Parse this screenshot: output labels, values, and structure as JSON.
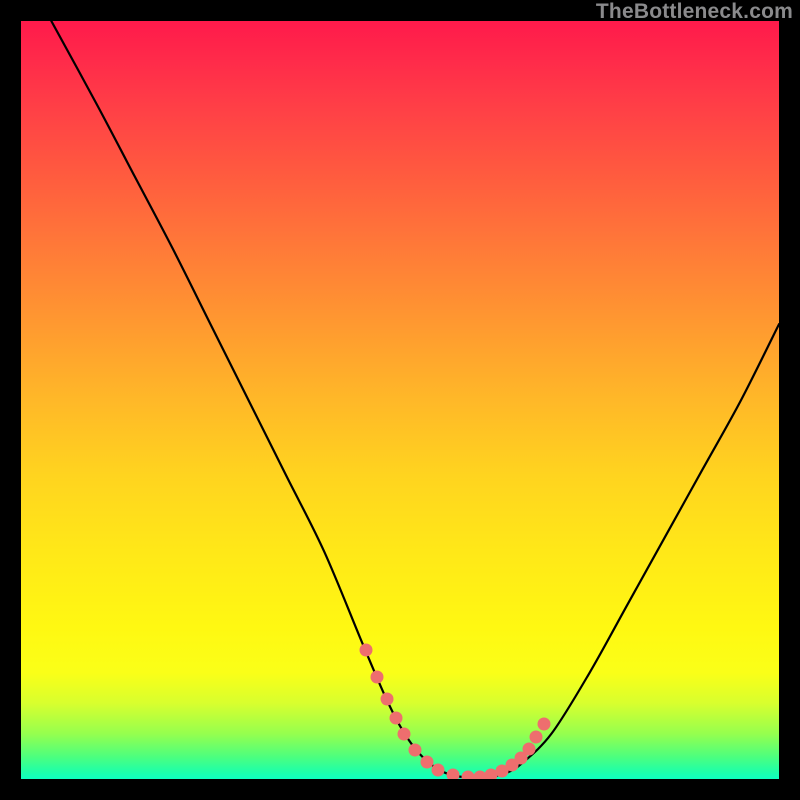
{
  "attribution": "TheBottleneck.com",
  "colors": {
    "page_bg": "#000000",
    "gradient_top": "#ff1a4b",
    "gradient_bottom": "#0effc0",
    "curve": "#000000",
    "dots": "#ee6e6e",
    "attribution": "#8a8a8c"
  },
  "chart_data": {
    "type": "line",
    "title": "",
    "xlabel": "",
    "ylabel": "",
    "xlim": [
      0,
      100
    ],
    "ylim": [
      0,
      100
    ],
    "grid": false,
    "legend": false,
    "series": [
      {
        "name": "bottleneck-curve",
        "x": [
          4,
          10,
          15,
          20,
          25,
          30,
          35,
          40,
          45,
          48,
          50,
          52,
          54,
          56,
          58,
          60,
          62,
          64,
          66,
          70,
          75,
          80,
          85,
          90,
          95,
          100
        ],
        "y": [
          100,
          89,
          79.5,
          70,
          60,
          50,
          40,
          30,
          18,
          11,
          7,
          4,
          2,
          0.8,
          0.3,
          0.2,
          0.3,
          0.8,
          2,
          6,
          14,
          23,
          32,
          41,
          50,
          60
        ]
      }
    ],
    "highlight_dots": {
      "name": "bottleneck-markers",
      "x": [
        45.5,
        47.0,
        48.3,
        49.5,
        50.5,
        52.0,
        53.5,
        55.0,
        57.0,
        59.0,
        60.5,
        62.0,
        63.5,
        64.8,
        66.0,
        67.0,
        68.0,
        69.0
      ],
      "y": [
        17.0,
        13.5,
        10.5,
        8.0,
        6.0,
        3.8,
        2.3,
        1.2,
        0.5,
        0.3,
        0.3,
        0.5,
        1.0,
        1.8,
        2.8,
        4.0,
        5.5,
        7.2
      ]
    },
    "gradient_stops": [
      {
        "pos": 0.0,
        "color": "#ff1a4b"
      },
      {
        "pos": 0.3,
        "color": "#ff7a38"
      },
      {
        "pos": 0.6,
        "color": "#ffd41f"
      },
      {
        "pos": 0.86,
        "color": "#faff18"
      },
      {
        "pos": 1.0,
        "color": "#0effc0"
      }
    ]
  }
}
